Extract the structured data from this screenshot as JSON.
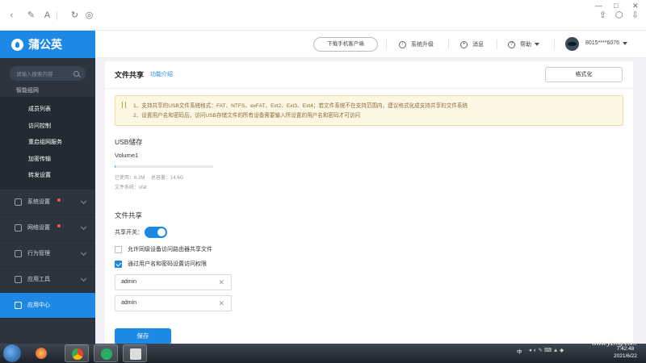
{
  "browser": {
    "icons": [
      "back-icon",
      "edit-icon",
      "font-icon",
      "refresh-icon",
      "compass-icon",
      "share-icon",
      "cube-icon",
      "download-icon"
    ],
    "window_controls": [
      "—",
      "□",
      "✕"
    ]
  },
  "brand": {
    "name": "蒲公英"
  },
  "sidebar": {
    "search_placeholder": "请输入搜索内容",
    "partial_header": "智能组网",
    "sub_items": [
      "成员列表",
      "访问控制",
      "重启组网服务",
      "加密传输",
      "转发设置"
    ],
    "menu": [
      {
        "label": "系统设置",
        "badge": true
      },
      {
        "label": "网络设置",
        "badge": true
      },
      {
        "label": "行为管理",
        "badge": false
      },
      {
        "label": "应用工具",
        "badge": false
      },
      {
        "label": "应用中心",
        "badge": false,
        "active": true
      }
    ]
  },
  "topbar": {
    "download_app": "下载手机客户端",
    "upgrade": "系统升级",
    "messages": "消息",
    "help": "帮助",
    "account": "8015****6076"
  },
  "page": {
    "title": "文件共享",
    "intro_link": "功能介绍",
    "format_button": "格式化",
    "notice": {
      "line1": "1、支持共享的USB文件系统格式：FAT、NTFS、exFAT、Ext2、Ext3、Ext4；若文件系统不在支持范围内，建议格式化成支持共享的文件系统",
      "line2": "2、设置用户名和密码后，访问USB存储文件的所有设备需要输入所设置的用户名和密码才可访问"
    },
    "usb": {
      "section_title": "USB储存",
      "volume_name": "Volume1",
      "used_label": "已使用：",
      "used_value": "6.3M",
      "total_label": "总容量：",
      "total_value": "14.6G",
      "fs_label": "文件系统：",
      "fs_value": "vfat",
      "usage_fraction": 0.0004
    },
    "share": {
      "section_title": "文件共享",
      "switch_label": "共享开关：",
      "switch_on": true,
      "option1": {
        "label": "允许同级设备访问路由器共享文件",
        "checked": false
      },
      "option2": {
        "label": "通过用户名和密码设置访问权限",
        "checked": true
      },
      "username": "admin",
      "password": "admin",
      "clear_glyph": "✕"
    },
    "save_button": "保存"
  },
  "taskbar": {
    "watermark": "www.yzmg.com",
    "time": "7:42:48",
    "date": "2021/6/22",
    "tray_text": "中"
  },
  "colors": {
    "primary": "#1e88e5",
    "sidebar": "#2c3440",
    "notice_bg": "#fdf6e3",
    "badge": "#ff4d4f"
  }
}
